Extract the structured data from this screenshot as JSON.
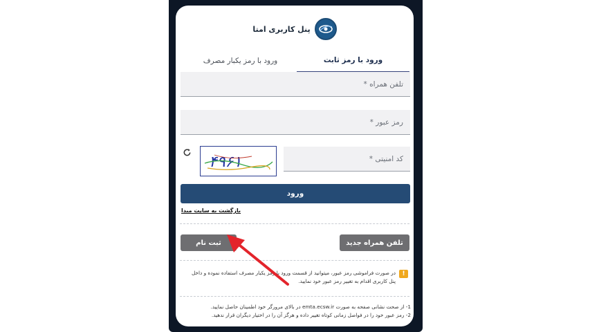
{
  "header": {
    "brand": "پنل کاربری امتا",
    "logo_icon": "emta-logo-icon"
  },
  "tabs": [
    {
      "label": "ورود با رمز ثابت",
      "active": true
    },
    {
      "label": "ورود با رمز یکبار مصرف",
      "active": false
    }
  ],
  "form": {
    "phone_placeholder": "تلفن همراه *",
    "password_placeholder": "رمز عبور *",
    "captcha_placeholder": "کد امنیتی *",
    "captcha_text": "۴۹۶۱",
    "refresh_icon": "refresh-icon"
  },
  "buttons": {
    "login": "ورود",
    "back_link": "بازگشت به سایت مبدا",
    "new_phone": "تلفن همراه جدید",
    "register": "ثبت نام"
  },
  "note": {
    "icon": "warning-icon",
    "text": "در صورت فراموشی رمز عبور، میتوانید از قسمت ورود با رمز یکبار مصرف استفاده نموده و داخل پنل کاربری اقدام به تغییر رمز عبور خود نمایید."
  },
  "tips": [
    "1- از صحت نشانی صفحه به صورت emta.ecsw.ir در بالای مرورگر خود اطمینان حاصل نمایید.",
    "2- رمز عبور خود را در فواصل زمانی کوتاه تغییر داده و هرگز آن را در اختیار دیگران قرار ندهید."
  ],
  "colors": {
    "primary": "#254b75",
    "tab_indicator": "#34427a",
    "grey_button": "#6e6e71",
    "warning": "#f0a81e",
    "annotation_arrow": "#e3242b",
    "phone_frame": "#0d1726"
  }
}
